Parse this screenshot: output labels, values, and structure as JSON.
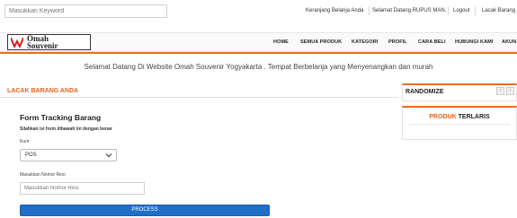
{
  "topbar": {
    "search_placeholder": "Masukkan Keyword",
    "links": [
      "Keranjang Belanja Anda",
      "Selamat Datang RUPUS MAN,",
      "Logout",
      "Lacak Barang"
    ]
  },
  "logo": {
    "line1": "Omah",
    "line2": "Souvenir"
  },
  "nav": [
    "HOME",
    "SEMUA PRODUK",
    "KATEGORI",
    "PROFIL",
    "CARA BELI",
    "HUBUNGI KAMI",
    "AKUN"
  ],
  "welcome": "Selamat Datang Di Website Omah Souvenir Yogyakarta . Tempat Berbelanja yang Menyenangkan dan murah",
  "lacak": {
    "section_title": "LACAK BARANG ANDA",
    "form_title": "Form Tracking Barang",
    "form_subtitle": "Silahkan isi form dibawah ini dengan benar",
    "kurir_label": "Kurir",
    "kurir_value": "POS",
    "resi_label": "Masukkan Nomor Resi",
    "resi_placeholder": "Masukkan Nomor Resi",
    "process_label": "PROCESS"
  },
  "sidebar": {
    "randomize_title": "RANDOMIZE",
    "prev": "‹",
    "next": "›",
    "produk_title_a": "PRODUK",
    "produk_title_b": "TERLARIS"
  },
  "colors": {
    "accent": "#f06a1e",
    "button": "#1f6fc8"
  }
}
